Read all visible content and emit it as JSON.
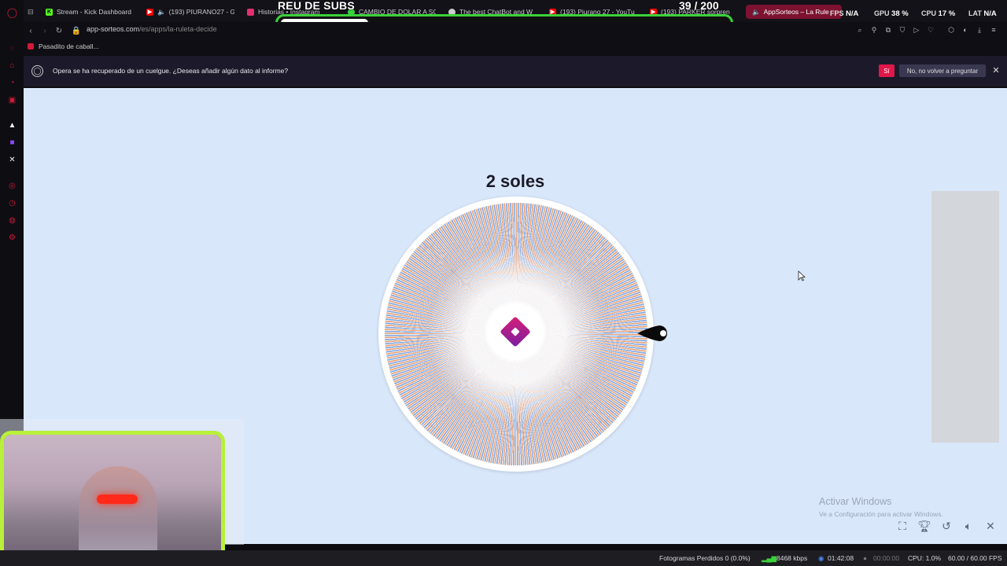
{
  "tabs": [
    {
      "label": "Stream - Kick Dashboard",
      "icon": "kick-icon",
      "color": "#53fc18"
    },
    {
      "label": "(193) PIURANO27 - G",
      "icon": "youtube-icon",
      "color": "#ff0000"
    },
    {
      "label": "Historias • Instagram",
      "icon": "instagram-icon",
      "color": "#e1306c"
    },
    {
      "label": "CAMBIO DE DOLAR A SO",
      "icon": "web-icon",
      "color": "#3ad13a"
    },
    {
      "label": "The best ChatBot and W",
      "icon": "chatbot-icon",
      "color": "#cccccc"
    },
    {
      "label": "(193) Piurano 27 - YouTu",
      "icon": "youtube-icon",
      "color": "#ff0000"
    },
    {
      "label": "(193) PARKER sorpren",
      "icon": "youtube-icon",
      "color": "#ff0000"
    },
    {
      "label": "AppSorteos – La Rule",
      "icon": "appsorteos-icon",
      "color": "#c4145a"
    }
  ],
  "overlay": {
    "title": "REU DE SUBS",
    "count": "39 / 200",
    "progress": 0.195
  },
  "hw": {
    "fps_label": "FPS",
    "fps_value": "N/A",
    "gpu_label": "GPU",
    "gpu_value": "38 %",
    "cpu_label": "CPU",
    "cpu_value": "17 %",
    "lat_label": "LAT",
    "lat_value": "N/A"
  },
  "address": {
    "host": "app-sorteos.com",
    "path": "/es/apps/la-ruleta-decide"
  },
  "bookmarks": [
    {
      "label": "Pasadito de caball..."
    }
  ],
  "infobar": {
    "message": "Opera se ha recuperado de un cuelgue. ¿Deseas añadir algún dato al informe?",
    "yes_label": "Sí",
    "no_label": "No, no volver a preguntar"
  },
  "page": {
    "prize": "2 soles",
    "watermark_title": "Activar Windows",
    "watermark_sub": "Ve a Configuración para activar Windows."
  },
  "statusbar": {
    "dropped": "Fotogramas Perdidos 0 (0.0%)",
    "bitrate": "8468 kbps",
    "live_time": "01:42:08",
    "rec_time": "00:00:00",
    "cpu": "CPU: 1.0%",
    "fps": "60.00 / 60.00 FPS"
  },
  "colors": {
    "accent": "#e0174a",
    "page_bg": "#d9e7fb",
    "goal_border": "#3bd13b",
    "webcam_border": "#b8f03a"
  }
}
